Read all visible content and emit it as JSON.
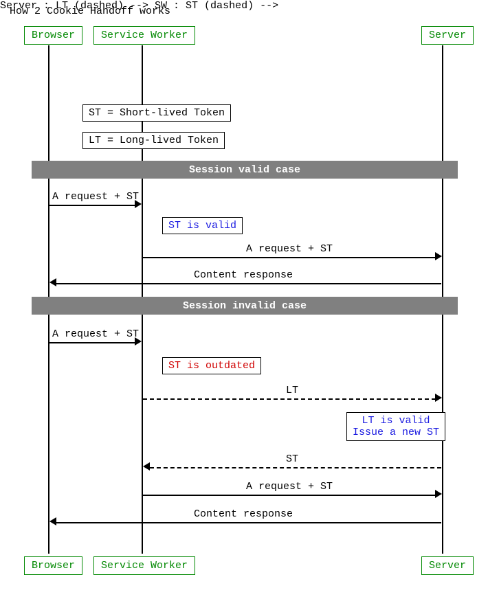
{
  "title": "How 2 Cookie Handoff works",
  "participants": {
    "browser": "Browser",
    "service_worker": "Service Worker",
    "server": "Server"
  },
  "notes": {
    "st_def": "ST = Short-lived Token",
    "lt_def": "LT = Long-lived Token",
    "st_valid": "ST is valid",
    "st_outdated": "ST is outdated",
    "lt_valid_line1": "LT is valid",
    "lt_valid_line2": "Issue a new ST"
  },
  "dividers": {
    "valid_case": "Session valid case",
    "invalid_case": "Session invalid case"
  },
  "messages": {
    "req_st_1": "A request + ST",
    "req_st_2": "A request + ST",
    "content_resp_1": "Content response",
    "req_st_3": "A request + ST",
    "lt": "LT",
    "st": "ST",
    "req_st_4": "A request + ST",
    "content_resp_2": "Content response"
  },
  "chart_data": {
    "type": "sequence_diagram",
    "title": "How 2 Cookie Handoff works",
    "participants": [
      "Browser",
      "Service Worker",
      "Server"
    ],
    "notes_top": [
      {
        "over": "Service Worker",
        "text": "ST = Short-lived Token"
      },
      {
        "over": "Service Worker",
        "text": "LT = Long-lived Token"
      }
    ],
    "groups": [
      {
        "label": "Session valid case",
        "events": [
          {
            "type": "message",
            "from": "Browser",
            "to": "Service Worker",
            "text": "A request + ST",
            "style": "solid"
          },
          {
            "type": "note",
            "over": "Service Worker",
            "text": "ST is valid",
            "color": "blue"
          },
          {
            "type": "message",
            "from": "Service Worker",
            "to": "Server",
            "text": "A request + ST",
            "style": "solid"
          },
          {
            "type": "message",
            "from": "Server",
            "to": "Browser",
            "text": "Content response",
            "style": "solid"
          }
        ]
      },
      {
        "label": "Session invalid case",
        "events": [
          {
            "type": "message",
            "from": "Browser",
            "to": "Service Worker",
            "text": "A request + ST",
            "style": "solid"
          },
          {
            "type": "note",
            "over": "Service Worker",
            "text": "ST is outdated",
            "color": "red"
          },
          {
            "type": "message",
            "from": "Service Worker",
            "to": "Server",
            "text": "LT",
            "style": "dashed"
          },
          {
            "type": "note",
            "over": "Server",
            "text": "LT is valid\nIssue a new ST",
            "color": "blue"
          },
          {
            "type": "message",
            "from": "Server",
            "to": "Service Worker",
            "text": "ST",
            "style": "dashed"
          },
          {
            "type": "message",
            "from": "Service Worker",
            "to": "Server",
            "text": "A request + ST",
            "style": "solid"
          },
          {
            "type": "message",
            "from": "Server",
            "to": "Browser",
            "text": "Content response",
            "style": "solid"
          }
        ]
      }
    ]
  }
}
